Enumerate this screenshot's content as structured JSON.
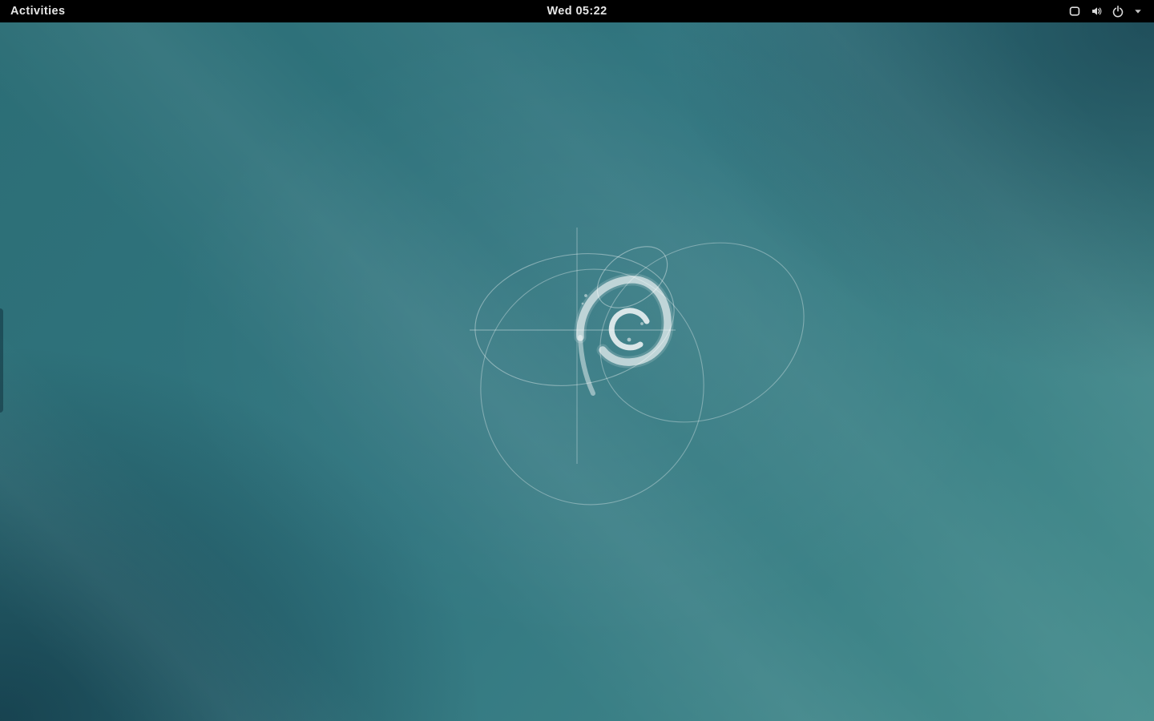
{
  "top_bar": {
    "activities_label": "Activities",
    "clock_label": "Wed 05:22",
    "status_icons": [
      {
        "id": "network-display-icon",
        "glyph": "rounded-screen-outline"
      },
      {
        "id": "volume-icon",
        "glyph": "speaker-with-waves"
      },
      {
        "id": "power-icon",
        "glyph": "power-symbol"
      },
      {
        "id": "system-menu-caret-icon",
        "glyph": "caret-down"
      }
    ]
  },
  "wallpaper": {
    "description": "Debian 'Lines' teal gradient wallpaper with Debian swirl drawn as thin construction ellipses, a crosshair and a thick brush-stroke spiral",
    "artwork_elements": [
      "crosshair-lines",
      "construction-ellipses",
      "debian-swirl",
      "paint-specks",
      "diagonal-light-beams"
    ]
  },
  "theme": {
    "panel_bg": "#000000",
    "panel_fg": "#e6e6e6",
    "wallpaper_top_left": "#2c6e76",
    "wallpaper_top_right": "#1c4a5c",
    "wallpaper_bottom_left": "#17455a",
    "wallpaper_bottom_right": "#478e8e",
    "wallpaper_center": "#317680",
    "artwork_line": "#ffffff"
  }
}
